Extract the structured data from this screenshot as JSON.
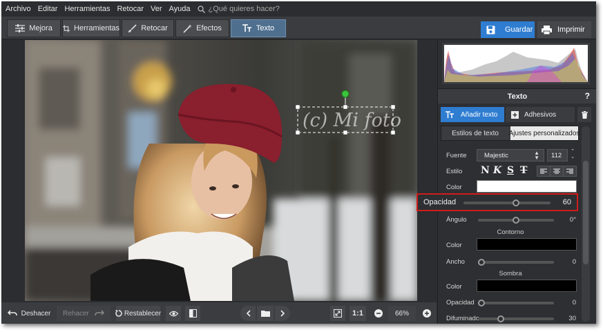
{
  "menu": {
    "items": [
      "Archivo",
      "Editar",
      "Herramientas",
      "Retocar",
      "Ver",
      "Ayuda"
    ],
    "search_placeholder": "¿Qué quieres hacer?"
  },
  "toolbar": {
    "tabs": [
      {
        "label": "Mejora",
        "icon": "sliders-icon"
      },
      {
        "label": "Herramientas",
        "icon": "crop-icon"
      },
      {
        "label": "Retocar",
        "icon": "brush-icon"
      },
      {
        "label": "Efectos",
        "icon": "magic-wand-icon"
      },
      {
        "label": "Texto",
        "icon": "text-icon"
      }
    ],
    "active_tab": "Texto",
    "save_label": "Guardar",
    "print_label": "Imprimir"
  },
  "canvas": {
    "overlay_text": "(c) Mi foto"
  },
  "bottombar": {
    "undo_label": "Deshacer",
    "redo_label": "Rehacer",
    "reset_label": "Restablecer",
    "actual_size_label": "1:1",
    "zoom_value": "66%"
  },
  "panel": {
    "section_title": "Texto",
    "help_label": "?",
    "add_text_label": "Añadir texto",
    "stickers_label": "Adhesivos",
    "subtabs": [
      "Estilos de texto",
      "Ajustes personalizados"
    ],
    "active_subtab": "Ajustes personalizados",
    "font_label": "Fuente",
    "font_value": "Majestic",
    "font_size": "112",
    "style_label": "Estilo",
    "style_glyphs": [
      "N",
      "K",
      "S",
      "T"
    ],
    "color_label": "Color",
    "text_color": "#ffffff",
    "opacity_label": "Opacidad",
    "opacity_value": "60",
    "opacity_fraction": 0.6,
    "angle_label": "Ángulo",
    "angle_value": "0°",
    "angle_fraction": 0.5,
    "outline_heading": "Contorno",
    "outline_color_label": "Color",
    "outline_color": "#000000",
    "outline_width_label": "Ancho",
    "outline_width_value": "0",
    "outline_width_fraction": 0,
    "shadow_heading": "Sombra",
    "shadow_color_label": "Color",
    "shadow_color": "#000000",
    "shadow_opacity_label": "Opacidad",
    "shadow_opacity_value": "0",
    "shadow_opacity_fraction": 0,
    "shadow_blur_label": "Difuminado",
    "shadow_blur_value": "30",
    "shadow_blur_fraction": 0.3
  },
  "colors": {
    "accent": "#2f7dd1",
    "highlight": "#d11c1c",
    "handle_green": "#3cc43c"
  }
}
